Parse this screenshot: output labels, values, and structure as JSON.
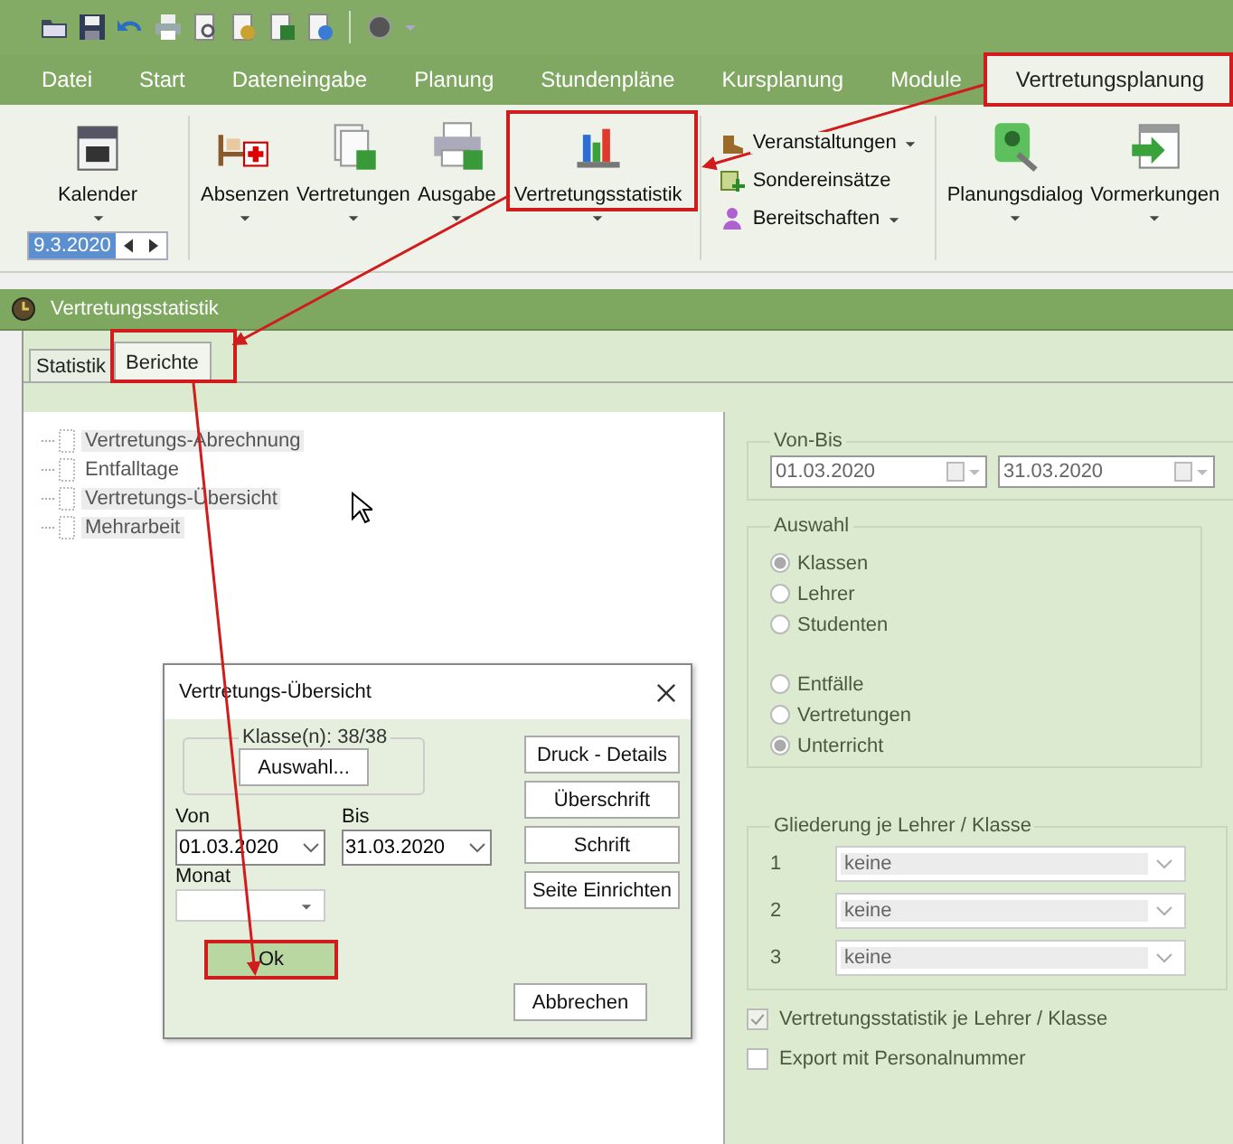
{
  "ribbon_tabs": [
    {
      "label": "Datei",
      "selected": false
    },
    {
      "label": "Start",
      "selected": false
    },
    {
      "label": "Dateneingabe",
      "selected": false
    },
    {
      "label": "Planung",
      "selected": false
    },
    {
      "label": "Stundenpläne",
      "selected": false
    },
    {
      "label": "Kursplanung",
      "selected": false
    },
    {
      "label": "Module",
      "selected": false
    },
    {
      "label": "Vertretungsplanung",
      "selected": true
    }
  ],
  "ribbon": {
    "calendar": {
      "label": "Kalender",
      "date": "9.3.2020"
    },
    "buttons": [
      {
        "label": "Absenzen"
      },
      {
        "label": "Vertretungen"
      },
      {
        "label": "Ausgabe"
      },
      {
        "label": "Vertretungsstatistik"
      }
    ],
    "small_buttons": [
      {
        "label": "Veranstaltungen",
        "dropdown": true
      },
      {
        "label": "Sondereinsätze",
        "dropdown": false
      },
      {
        "label": "Bereitschaften",
        "dropdown": true
      }
    ],
    "planning_buttons": [
      {
        "label": "Planungsdialog"
      },
      {
        "label": "Vormerkungen"
      }
    ]
  },
  "window": {
    "title": "Vertretungsstatistik",
    "tabs": [
      {
        "label": "Statistik",
        "selected": false
      },
      {
        "label": "Berichte",
        "selected": true
      }
    ],
    "reports": [
      {
        "label": "Vertretungs-Abrechnung",
        "selected": true
      },
      {
        "label": "Entfalltage",
        "selected": false
      },
      {
        "label": "Vertretungs-Übersicht",
        "selected": true
      },
      {
        "label": "Mehrarbeit",
        "selected": true
      }
    ],
    "date_range": {
      "title": "Von-Bis",
      "from": "01.03.2020",
      "to": "31.03.2020"
    },
    "selection": {
      "title": "Auswahl",
      "groups": [
        [
          {
            "label": "Klassen",
            "selected": true
          },
          {
            "label": "Lehrer",
            "selected": false
          },
          {
            "label": "Studenten",
            "selected": false
          }
        ],
        [
          {
            "label": "Entfälle",
            "selected": false
          },
          {
            "label": "Vertretungen",
            "selected": false
          },
          {
            "label": "Unterricht",
            "selected": true
          }
        ]
      ]
    },
    "grouping": {
      "title": "Gliederung je Lehrer / Klasse",
      "rows": [
        {
          "number": "1",
          "value": "keine"
        },
        {
          "number": "2",
          "value": "keine"
        },
        {
          "number": "3",
          "value": "keine"
        }
      ]
    },
    "options": [
      {
        "label": "Vertretungsstatistik je Lehrer / Klasse",
        "checked": true
      },
      {
        "label": "Export mit Personalnummer",
        "checked": false
      }
    ]
  },
  "dialog": {
    "title": "Vertretungs-Übersicht",
    "classes_label": "Klasse(n): 38/38",
    "select_button": "Auswahl...",
    "from_label": "Von",
    "from": "01.03.2020",
    "to_label": "Bis",
    "to": "31.03.2020",
    "month_label": "Monat",
    "side_buttons": [
      "Druck - Details",
      "Überschrift",
      "Schrift",
      "Seite Einrichten"
    ],
    "ok": "Ok",
    "cancel": "Abbrechen"
  }
}
